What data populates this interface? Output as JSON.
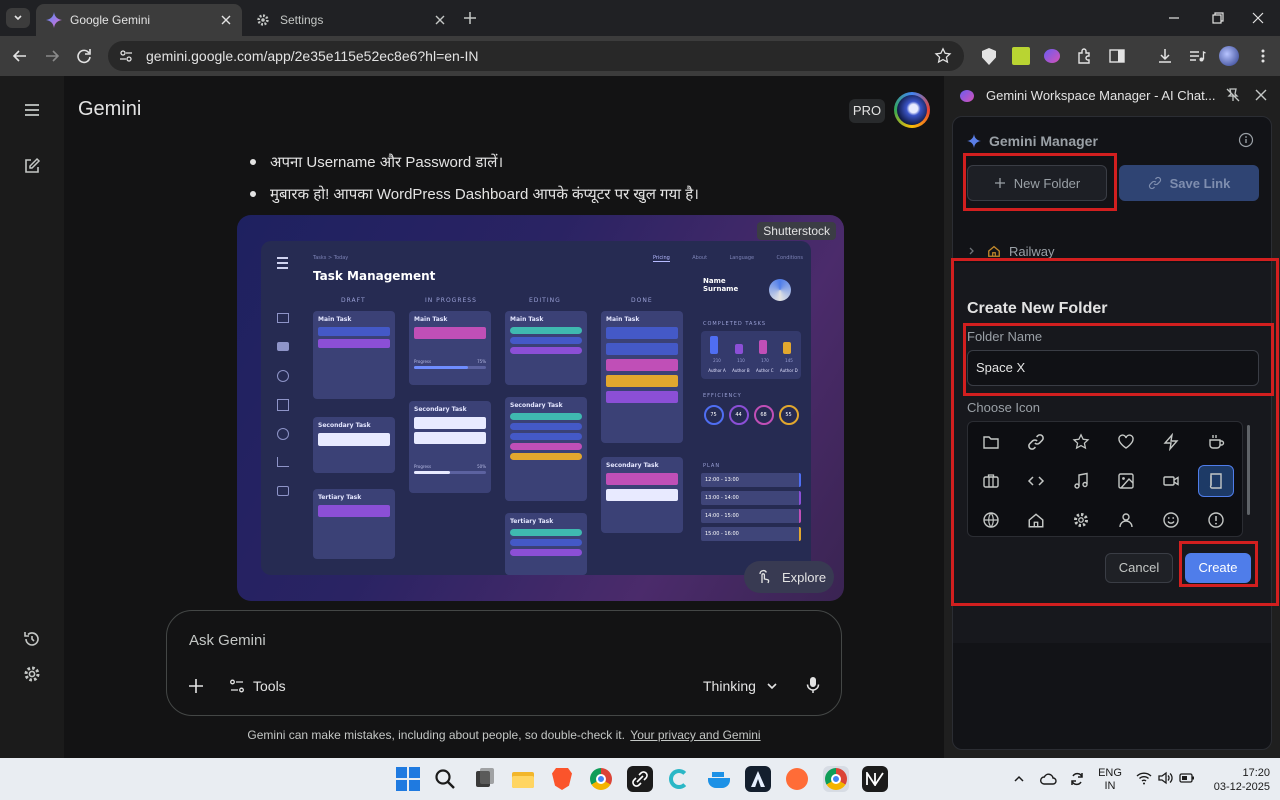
{
  "browser": {
    "tabs": [
      {
        "label": "Google Gemini",
        "active": true
      },
      {
        "label": "Settings",
        "active": false
      }
    ],
    "url": "gemini.google.com/app/2e35e115e52ec8e6?hl=en-IN"
  },
  "gemini": {
    "brand": "Gemini",
    "pro_badge": "PRO",
    "bullets": [
      "अपना Username और Password डालें।",
      "मुबारक हो! आपका WordPress Dashboard आपके कंप्यूटर पर खुल गया है।"
    ],
    "image": {
      "source_badge": "Shutterstock",
      "explore_label": "Explore",
      "mock": {
        "breadcrumb": "Tasks > Today",
        "title": "Task Management",
        "tabs": [
          "Pricing",
          "About",
          "Language",
          "Conditions"
        ],
        "columns": [
          "DRAFT",
          "IN PROGRESS",
          "EDITING",
          "DONE"
        ],
        "card_titles": [
          "Main Task",
          "Secondary Task",
          "Tertiary Task"
        ],
        "name_label": "Name Surname",
        "completed_label": "COMPLETED TASKS",
        "completed_values": [
          "210",
          "110",
          "170",
          "145"
        ],
        "authors": [
          "Author A",
          "Author B",
          "Author C",
          "Author D"
        ],
        "efficiency_label": "EFFICIENCY",
        "efficiency_values": [
          "75",
          "44",
          "68",
          "55"
        ],
        "plan_label": "PLAN",
        "plan_times": [
          "12:00 - 13:00",
          "13:00 - 14:00",
          "14:00 - 15:00",
          "15:00 - 16:00"
        ],
        "progress_label": "Progress",
        "progress_values": [
          "75%",
          "50%"
        ]
      }
    },
    "composer": {
      "placeholder": "Ask Gemini",
      "tools_label": "Tools",
      "mode_label": "Thinking"
    },
    "disclaimer": "Gemini can make mistakes, including about people, so double-check it.",
    "disclaimer_link": "Your privacy and Gemini"
  },
  "side_panel": {
    "title": "Gemini Workspace Manager - AI Chat...",
    "app_title": "Gemini Manager",
    "new_folder_label": "New Folder",
    "save_link_label": "Save Link",
    "folder_item": "Railway",
    "dialog": {
      "title": "Create New Folder",
      "folder_name_label": "Folder Name",
      "folder_name_value": "Space X",
      "choose_icon_label": "Choose Icon",
      "icons": [
        "folder-icon",
        "link-icon",
        "star-icon",
        "heart-icon",
        "bolt-icon",
        "coffee-icon",
        "briefcase-icon",
        "code-icon",
        "music-icon",
        "image-icon",
        "video-icon",
        "book-icon",
        "globe-icon",
        "home-icon",
        "settings-icon",
        "user-icon",
        "smile-icon",
        "alert-icon"
      ],
      "selected_icon": "book-icon",
      "cancel_label": "Cancel",
      "create_label": "Create"
    }
  },
  "taskbar": {
    "lang_top": "ENG",
    "lang_bottom": "IN",
    "time": "17:20",
    "date": "03-12-2025"
  },
  "colors": {
    "accent_blue": "#4f7dea",
    "highlight_red": "#d21f1f",
    "panel_bg": "#1f1f1f",
    "main_bg": "#131314"
  }
}
